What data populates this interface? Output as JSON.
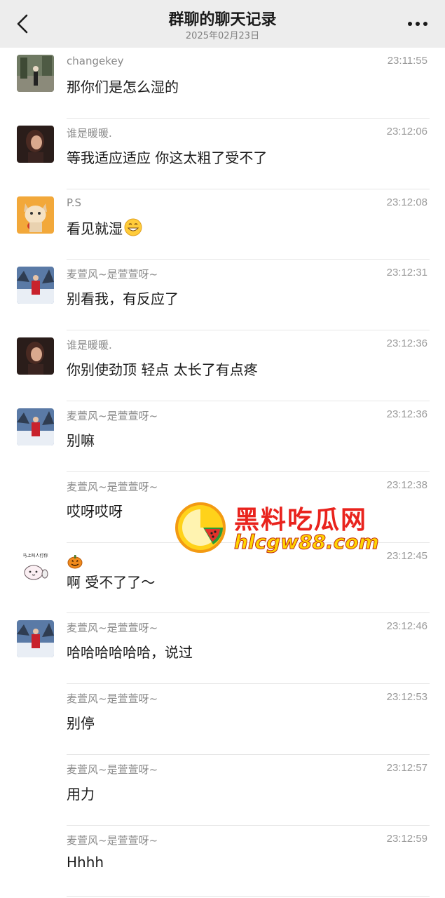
{
  "header": {
    "title": "群聊的聊天记录",
    "date": "2025年02月23日",
    "back_icon": "chevron-left-icon",
    "more_icon": "more-dots-icon"
  },
  "messages": [
    {
      "sender": "changekey",
      "time": "23:11:55",
      "text": "那你们是怎么湿的",
      "avatar": "photo-street"
    },
    {
      "sender": "谁是暖暖.",
      "time": "23:12:06",
      "text": "等我适应适应 你这太粗了受不了",
      "avatar": "photo-girl"
    },
    {
      "sender": "P.S",
      "time": "23:12:08",
      "text": "看见就湿",
      "avatar": "cartoon-cat",
      "emoji": "grinning-face"
    },
    {
      "sender": "麦萱风~是萱萱呀~",
      "time": "23:12:31",
      "text": "别看我，有反应了",
      "avatar": "photo-snow"
    },
    {
      "sender": "谁是暖暖.",
      "time": "23:12:36",
      "text": "你别使劲顶 轻点 太长了有点疼",
      "avatar": "photo-girl"
    },
    {
      "sender": "麦萱风~是萱萱呀~",
      "time": "23:12:36",
      "text": "别嘛",
      "avatar": "photo-snow"
    },
    {
      "sender": "麦萱风~是萱萱呀~",
      "time": "23:12:38",
      "text": "哎呀哎呀",
      "avatar": ""
    },
    {
      "sender": "",
      "time": "23:12:45",
      "text": "啊 受不了了～",
      "avatar": "sticker-cat",
      "avatar_caption": "马上叫人打你",
      "emoji": "pumpkin"
    },
    {
      "sender": "麦萱风~是萱萱呀~",
      "time": "23:12:46",
      "text": "哈哈哈哈哈哈，说过",
      "avatar": "photo-snow"
    },
    {
      "sender": "麦萱风~是萱萱呀~",
      "time": "23:12:53",
      "text": "别停",
      "avatar": ""
    },
    {
      "sender": "麦萱风~是萱萱呀~",
      "time": "23:12:57",
      "text": "用力",
      "avatar": ""
    },
    {
      "sender": "麦萱风~是萱萱呀~",
      "time": "23:12:59",
      "text": "Hhhh",
      "avatar": ""
    }
  ],
  "watermark": {
    "name": "黑料吃瓜网",
    "url": "hlcgw88.com"
  },
  "colors": {
    "header_bg": "#ededed",
    "sender": "#8a8a8a",
    "time": "#9a9a9a",
    "message": "#1a1a1a",
    "watermark_red": "#e9231d",
    "watermark_yellow": "#ffd400"
  }
}
